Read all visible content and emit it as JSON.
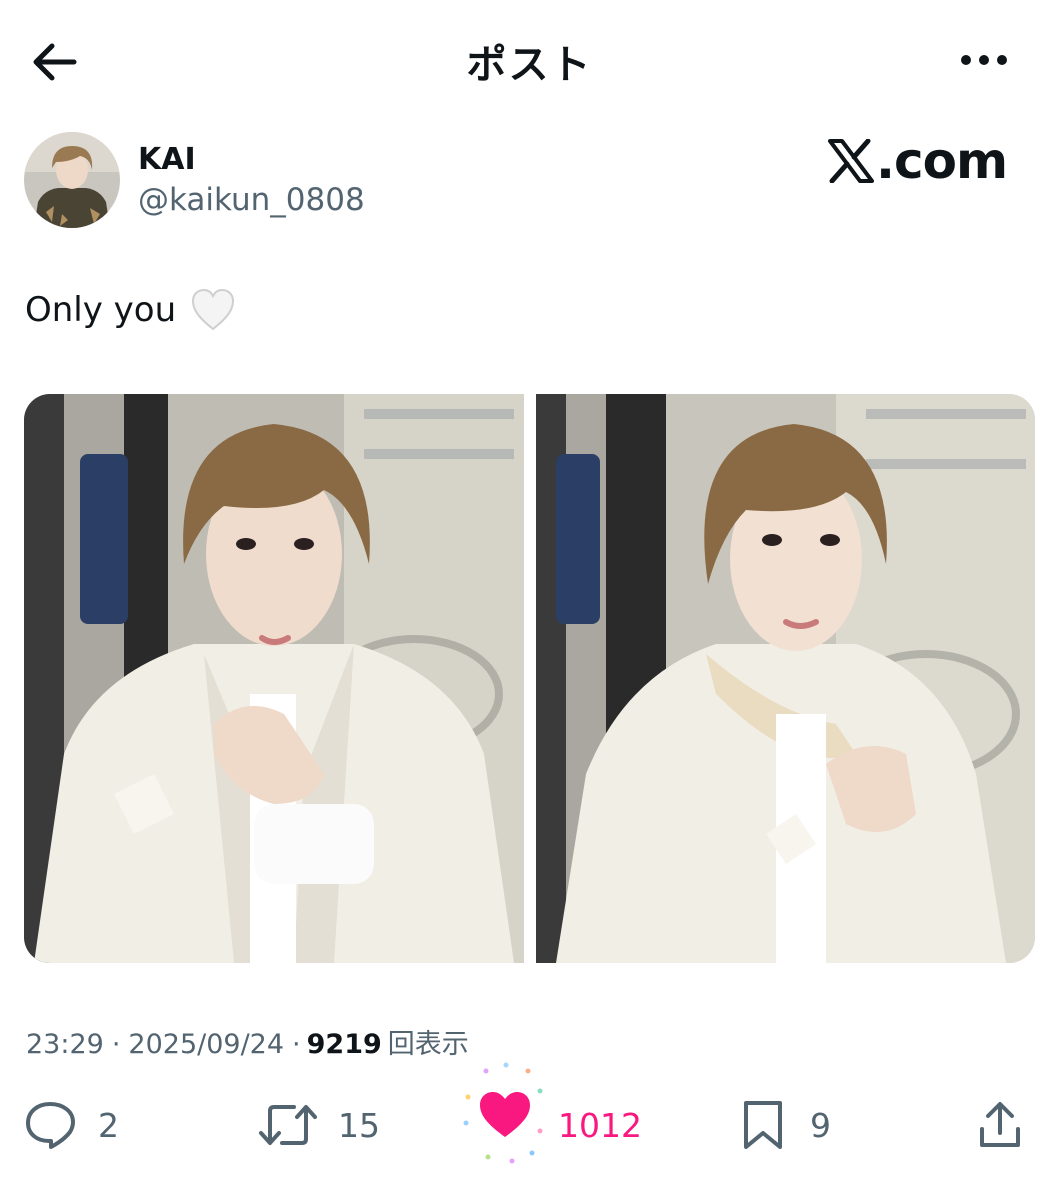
{
  "header": {
    "title": "ポスト",
    "back_icon": "arrow-left-icon",
    "more_icon": "ellipsis-icon"
  },
  "author": {
    "display_name": "KAI",
    "handle": "@kaikun_0808"
  },
  "watermark": {
    "text": ".com",
    "logo": "x-logo-icon"
  },
  "post": {
    "text": "Only you",
    "emoji": "white-heart-icon"
  },
  "meta": {
    "time": "23:29",
    "separator": "·",
    "date": "2025/09/24",
    "views": "9219",
    "views_label": "回表示"
  },
  "actions": {
    "replies": "2",
    "reposts": "15",
    "likes": "1012",
    "bookmarks": "9",
    "like_color": "#f91880"
  },
  "colors": {
    "text": "#0f1419",
    "secondary": "#536471",
    "like": "#f91880"
  }
}
